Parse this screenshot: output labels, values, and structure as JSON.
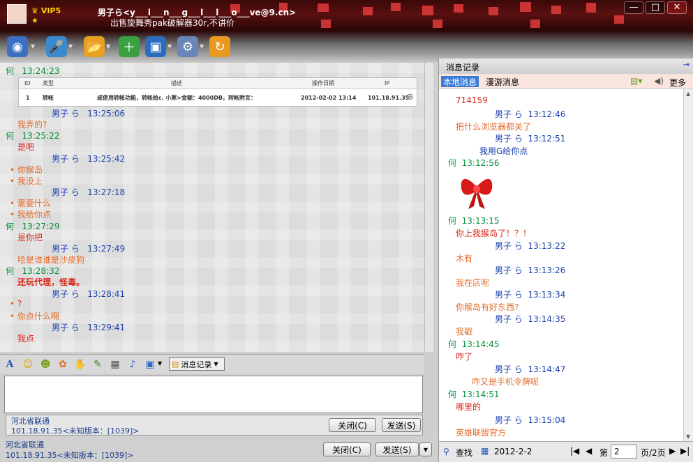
{
  "window": {
    "contact_name": "男子ら<y___i___n___g___l___l___o___ve@9.cn>",
    "vip_label": "VIP5",
    "signature": "出售旋舞秀pak破解器30r,不讲价",
    "minimize": "—",
    "maximize": "□",
    "close": "✕"
  },
  "toolbar": {
    "icons": [
      "video-call-icon",
      "voice-call-icon",
      "send-file-icon",
      "add-app-icon",
      "remote-assist-icon",
      "settings-icon",
      "sync-icon"
    ]
  },
  "chat": {
    "messages": [
      {
        "sender": "何",
        "time": "13:24:23",
        "type": "he"
      },
      {
        "table_header": [
          "ID",
          "类型",
          "描述",
          "操作日期",
          "IP"
        ],
        "table_row": [
          "1",
          "转帐",
          "咸使用转帐功能，转帐给ε.    小寒>金额：4000DB，转帐附言：",
          "2012-02-02 13:14",
          "101.18.91.35"
        ]
      },
      {
        "sender": "男子 ら",
        "time": "13:25:06",
        "type": "me"
      },
      {
        "text": "我弄的?",
        "type": "orange"
      },
      {
        "sender": "何",
        "time": "13:25:22",
        "type": "he"
      },
      {
        "text": "是吧",
        "type": "red"
      },
      {
        "sender": "男子 ら",
        "time": "13:25:42",
        "type": "me"
      },
      {
        "text": "你猴岛",
        "type": "bullet"
      },
      {
        "text": "我没上",
        "type": "bullet"
      },
      {
        "sender": "男子 ら",
        "time": "13:27:18",
        "type": "me"
      },
      {
        "text": "需要什么",
        "type": "bullet"
      },
      {
        "text": "我给你点",
        "type": "bullet"
      },
      {
        "sender": "何",
        "time": "13:27:29",
        "type": "he"
      },
      {
        "text": "是你把",
        "type": "red"
      },
      {
        "sender": "男子 ら",
        "time": "13:27:49",
        "type": "me"
      },
      {
        "text": "哈是谁谁是沙皮狗",
        "type": "orange"
      },
      {
        "sender": "何",
        "time": "13:28:32",
        "type": "he"
      },
      {
        "text": "还玩代理，怪毒。",
        "type": "red"
      },
      {
        "sender": "男子 ら",
        "time": "13:28:41",
        "type": "me"
      },
      {
        "text": "?",
        "type": "bullet"
      },
      {
        "text": "你点什么啊",
        "type": "bullet"
      },
      {
        "sender": "男子 ら",
        "time": "13:29:41",
        "type": "me"
      },
      {
        "text": "我点",
        "type": "red"
      }
    ]
  },
  "input_toolbar": {
    "msg_record_label": "消息记录"
  },
  "input": {
    "location": "河北省联通",
    "ip_version": "101.18.91.35<未知版本：[1039]>",
    "close_label": "关闭(C)",
    "send_label": "发送(S)"
  },
  "bottom": {
    "location": "河北省联通",
    "ip_version": "101.18.91.35<未知版本：[1039]>",
    "close_label": "关闭(C)",
    "send_label": "发送(S)"
  },
  "history": {
    "title": "消息记录",
    "tab_local": "本地消息",
    "tab_roam": "漫游消息",
    "more": "更多",
    "messages": [
      {
        "text": "714159",
        "type": "red"
      },
      {
        "sender": "男子 ら",
        "time": "13:12:46",
        "type": "me"
      },
      {
        "text": "把什么浏览器都关了",
        "type": "orange"
      },
      {
        "sender": "男子 ら",
        "time": "13:12:51",
        "type": "me"
      },
      {
        "text": "我用G给你点",
        "type": "blue"
      },
      {
        "sender": "何",
        "time": "13:12:56",
        "type": "he"
      },
      {
        "sender": "何",
        "time": "13:13:15",
        "type": "he"
      },
      {
        "text": "你上我猴岛了！？！",
        "type": "red"
      },
      {
        "sender": "男子 ら",
        "time": "13:13:22",
        "type": "me"
      },
      {
        "text": "木有",
        "type": "orange"
      },
      {
        "sender": "男子 ら",
        "time": "13:13:26",
        "type": "me"
      },
      {
        "text": "我在店呢",
        "type": "orange"
      },
      {
        "sender": "男子 ら",
        "time": "13:13:34",
        "type": "me"
      },
      {
        "text": "你猴岛有好东西?",
        "type": "orange"
      },
      {
        "sender": "男子 ら",
        "time": "13:14:35",
        "type": "me"
      },
      {
        "text": "我戳",
        "type": "orange"
      },
      {
        "sender": "何",
        "time": "13:14:45",
        "type": "he"
      },
      {
        "text": "咋了",
        "type": "red"
      },
      {
        "sender": "男子 ら",
        "time": "13:14:47",
        "type": "me"
      },
      {
        "text": "咋又是手机令牌呢",
        "type": "orange"
      },
      {
        "sender": "何",
        "time": "13:14:51",
        "type": "he"
      },
      {
        "text": "哪里的",
        "type": "red"
      },
      {
        "sender": "男子 ら",
        "time": "13:15:04",
        "type": "me"
      },
      {
        "text": "英雄联盟官方",
        "type": "orange"
      }
    ],
    "search_label": "查找",
    "date": "2012-2-2",
    "page_prefix": "第",
    "page_value": "2",
    "page_suffix": "页/2页"
  }
}
